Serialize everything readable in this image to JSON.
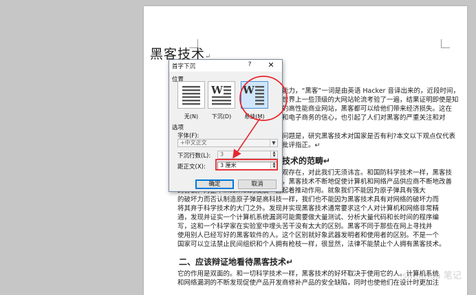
{
  "document": {
    "title": "黑客技术",
    "title_mark": "↵",
    "lines": [
      "能力，“黑客”一词是由英语 Hacker 音译出来的，近段时间，",
      "世界上一些顶级的大网站轮流考验了一遍，结果证明即使是知",
      "的高性能商业网站，黑客都可以给他们带来经济损失。这在",
      "和电子商务的信心，也引起了人们对黑客的严重关注和对",
      "问题是，研究黑客技术对国家是否有利?本文以下观点仅代表",
      "批评指正。↵",
      "观存在，对此我们无须讳言。和国防科学技术一样，黑客技",
      "，黑客技术不断地促使计算机和网络产品供应商不断地改善",
      "的协议，对整个Internet的发展一直起着推动作用。就象我们不能因为原子弹具有强大",
      "的破坏力而否认制造原子弹是高科技一样，我们也不能因为黑客技术具有对网络的破坏力而",
      "将其弃于科学技术的大门之外。发现并实现黑客技术通常要求这个人对计算机和网络非常精",
      "通，发现并证实一个计算机系统漏洞可能需要做大量测试、分析大量代码和长时间的程序编",
      "写，这和一个科学家在实验室中埋头苦干没有太大的区别。黑客不同于那些在网上寻找并",
      "使用别人已经写好的黑客软件的人。这个区别就好象武器发明者和使用者的区别。不是一个",
      "国家可以立法禁止民间组织和个人拥有枪枝一样，很显然，法律不能禁止个人拥有黑客技术。",
      "它的作用是双面的。和一切科学技术一样，黑客技术的好坏取决于使用它的人。计算机系统",
      "和网络漏洞的不断发现促使产品开发商修补产品的安全缺陷，同时也使他们在设计时更加注"
    ],
    "heading_partial": "技术的范畴↵",
    "heading_2": "二、应该辩证地看待黑客技术↵"
  },
  "dialog": {
    "title": "首字下沉",
    "help": "?",
    "close": "✕",
    "position_label": "位置",
    "options": [
      {
        "label": "无(N)",
        "selected": false
      },
      {
        "label": "下沉(D)",
        "selected": false
      },
      {
        "label": "悬挂(M)",
        "selected": true
      }
    ],
    "glyph": "W",
    "options_label": "选项",
    "font_label": "字体(F):",
    "font_value": "+中文正文",
    "lines_label": "下沉行数(L):",
    "lines_value": "3",
    "distance_label": "距正文(X):",
    "distance_value": "3 厘米",
    "ok_label": "确定",
    "cancel_label": "取消"
  },
  "annotation_color": "#e8262d",
  "watermark": "shenhua 笔记"
}
